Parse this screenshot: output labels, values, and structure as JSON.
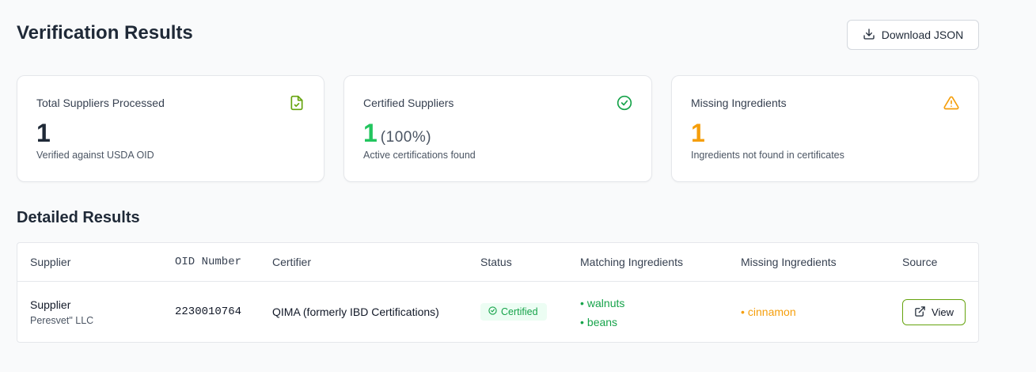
{
  "header": {
    "title": "Verification Results",
    "download_label": "Download JSON"
  },
  "cards": {
    "total": {
      "title": "Total Suppliers Processed",
      "value": "1",
      "sub": "Verified against USDA OID",
      "icon": "file-check-icon",
      "color": "#1f2937",
      "icon_color": "#65a30d"
    },
    "certified": {
      "title": "Certified Suppliers",
      "value": "1",
      "pct": "(100%)",
      "sub": "Active certifications found",
      "icon": "check-circle-icon",
      "color": "#22c55e",
      "icon_color": "#16a34a"
    },
    "missing": {
      "title": "Missing Ingredients",
      "value": "1",
      "sub": "Ingredients not found in certificates",
      "icon": "warning-triangle-icon",
      "color": "#f59e0b",
      "icon_color": "#f59e0b"
    }
  },
  "details": {
    "title": "Detailed Results",
    "columns": [
      "Supplier",
      "OID Number",
      "Certifier",
      "Status",
      "Matching Ingredients",
      "Missing Ingredients",
      "Source"
    ],
    "rows": [
      {
        "supplier": "Supplier",
        "supplier_sub": "Peresvet\" LLC",
        "oid": "2230010764",
        "certifier": "QIMA (formerly IBD Certifications)",
        "status": "Certified",
        "matching": [
          "walnuts",
          "beans"
        ],
        "missing": [
          "cinnamon"
        ],
        "source_label": "View"
      }
    ]
  },
  "colors": {
    "green": "#16a34a",
    "amber": "#f59e0b",
    "border_accent": "#65a30d"
  }
}
